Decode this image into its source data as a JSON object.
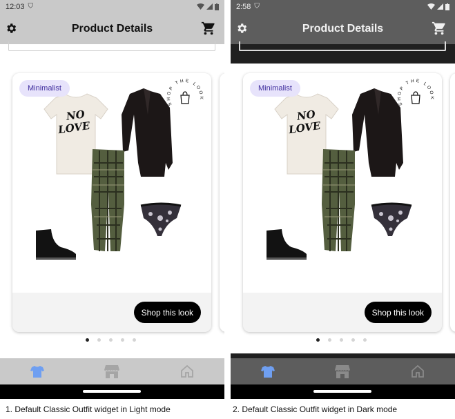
{
  "screens": [
    {
      "mode": "light",
      "status": {
        "time": "12:03"
      },
      "appbar": {
        "title": "Product Details"
      },
      "card": {
        "tag": "Minimalist",
        "cta": "Shop this look",
        "stamp": "SHOP THE LOOK"
      },
      "carousel": {
        "total": 5,
        "active": 0
      },
      "caption": "1. Default Classic Outfit widget in Light mode"
    },
    {
      "mode": "dark",
      "status": {
        "time": "2:58"
      },
      "appbar": {
        "title": "Product Details"
      },
      "card": {
        "tag": "Minimalist",
        "cta": "Shop this look",
        "stamp": "SHOP THE LOOK"
      },
      "carousel": {
        "total": 5,
        "active": 0
      },
      "caption": "2. Default Classic Outfit widget in Dark mode"
    }
  ],
  "products": {
    "tshirt_print": "NO LOVE"
  },
  "colors": {
    "accent": "#6f9ff1",
    "badge_bg": "#e7e3fb",
    "badge_text": "#3f2d9e",
    "cta_bg": "#000000"
  }
}
